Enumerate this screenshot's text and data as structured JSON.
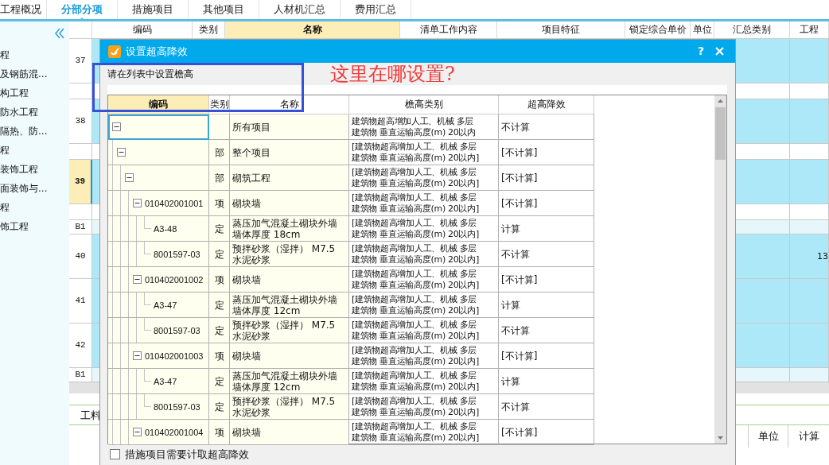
{
  "tabs": [
    {
      "label": "工程概况",
      "selected": false
    },
    {
      "label": "分部分项",
      "selected": true
    },
    {
      "label": "措施项目",
      "selected": false
    },
    {
      "label": "其他项目",
      "selected": false
    },
    {
      "label": "人材机汇总",
      "selected": false
    },
    {
      "label": "费用汇总",
      "selected": false
    }
  ],
  "sidebar": {
    "items": [
      "程",
      "及钢筋混...",
      "构工程",
      "防水工程",
      "隔热、防...",
      "程",
      "装饰工程",
      "面装饰与...",
      "程",
      "饰工程"
    ]
  },
  "table": {
    "columns": [
      {
        "label": "编码",
        "selected": false
      },
      {
        "label": "类别",
        "selected": false
      },
      {
        "label": "名称",
        "selected": true
      },
      {
        "label": "清单工作内容",
        "selected": false
      },
      {
        "label": "项目特征",
        "selected": false
      },
      {
        "label": "锁定综合单价",
        "selected": false
      },
      {
        "label": "单位",
        "selected": false
      },
      {
        "label": "汇总类别",
        "selected": false
      },
      {
        "label": "工程",
        "selected": false
      }
    ],
    "rows": [
      {
        "kind": "item",
        "number": "37",
        "selected": false
      },
      {
        "kind": "blank",
        "selected": false
      },
      {
        "kind": "item",
        "number": "38",
        "selected": false
      },
      {
        "kind": "blank",
        "selected": false
      },
      {
        "kind": "item",
        "number": "39",
        "selected": true
      },
      {
        "kind": "blank",
        "selected": false
      },
      {
        "kind": "sub",
        "number": "B1",
        "selected": false
      },
      {
        "kind": "item",
        "number": "40",
        "selected": false,
        "last_column": "13"
      },
      {
        "kind": "item",
        "number": "41",
        "selected": false
      },
      {
        "kind": "item",
        "number": "42",
        "selected": false
      },
      {
        "kind": "sub",
        "number": "B1",
        "selected": false
      }
    ]
  },
  "bottom_panel": {
    "tab": "工料",
    "columns": [
      "单位",
      "计算"
    ]
  },
  "dialog": {
    "title": "设置超高降效",
    "help": "?",
    "prompt": "请在列表中设置檐高",
    "annotation": "这里在哪设置?",
    "columns": [
      {
        "label": "编码",
        "selected": true
      },
      {
        "label": "类别",
        "selected": false
      },
      {
        "label": "名称",
        "selected": false
      },
      {
        "label": "檐高类别",
        "selected": false
      },
      {
        "label": "超高降效",
        "selected": false
      }
    ],
    "tree": [
      {
        "name": [
          "所有项目"
        ],
        "height_category": [
          "建筑物超高增加人工、机械 多层",
          "建筑物 垂直运输高度(m) 20以内"
        ],
        "reduction": "不计算",
        "expanded": true,
        "selected": true,
        "children": [
          {
            "type": "部",
            "name": [
              "整个项目"
            ],
            "height_category": [
              "[建筑物超高增加人工、机械 多层",
              "建筑物 垂直运输高度(m) 20以内]"
            ],
            "reduction": "[不计算]",
            "expanded": true,
            "selected": false,
            "children": [
              {
                "type": "部",
                "name": [
                  "砌筑工程"
                ],
                "height_category": [
                  "[建筑物超高增加人工、机械 多层",
                  "建筑物 垂直运输高度(m) 20以内]"
                ],
                "reduction": "[不计算]",
                "expanded": true,
                "selected": false,
                "children": [
                  {
                    "code": "010402001001",
                    "type": "项",
                    "name": [
                      "砌块墙"
                    ],
                    "height_category": [
                      "[建筑物超高增加人工、机械 多层",
                      "建筑物 垂直运输高度(m) 20以内]"
                    ],
                    "reduction": "[不计算]",
                    "expanded": true,
                    "selected": false,
                    "children": [
                      {
                        "code": "A3-48",
                        "type": "定",
                        "name": [
                          "蒸压加气混凝土砌块外墙",
                          "墙体厚度 18cm"
                        ],
                        "height_category": [
                          "[建筑物超高增加人工、机械 多层",
                          "建筑物 垂直运输高度(m) 20以内]"
                        ],
                        "reduction": "计算",
                        "selected": false
                      },
                      {
                        "code": "8001597-03",
                        "type": "定",
                        "name": [
                          "预拌砂浆（湿拌） M7.5",
                          "水泥砂浆"
                        ],
                        "height_category": [
                          "[建筑物超高增加人工、机械 多层",
                          "建筑物 垂直运输高度(m) 20以内]"
                        ],
                        "reduction": "不计算",
                        "selected": false
                      }
                    ]
                  },
                  {
                    "code": "010402001002",
                    "type": "项",
                    "name": [
                      "砌块墙"
                    ],
                    "height_category": [
                      "[建筑物超高增加人工、机械 多层",
                      "建筑物 垂直运输高度(m) 20以内]"
                    ],
                    "reduction": "[不计算]",
                    "expanded": true,
                    "selected": false,
                    "children": [
                      {
                        "code": "A3-47",
                        "type": "定",
                        "name": [
                          "蒸压加气混凝土砌块外墙",
                          "墙体厚度 12cm"
                        ],
                        "height_category": [
                          "[建筑物超高增加人工、机械 多层",
                          "建筑物 垂直运输高度(m) 20以内]"
                        ],
                        "reduction": "计算",
                        "selected": false
                      },
                      {
                        "code": "8001597-03",
                        "type": "定",
                        "name": [
                          "预拌砂浆（湿拌） M7.5",
                          "水泥砂浆"
                        ],
                        "height_category": [
                          "[建筑物超高增加人工、机械 多层",
                          "建筑物 垂直运输高度(m) 20以内]"
                        ],
                        "reduction": "不计算",
                        "selected": false
                      }
                    ]
                  },
                  {
                    "code": "010402001003",
                    "type": "项",
                    "name": [
                      "砌块墙"
                    ],
                    "height_category": [
                      "[建筑物超高增加人工、机械 多层",
                      "建筑物 垂直运输高度(m) 20以内]"
                    ],
                    "reduction": "[不计算]",
                    "expanded": true,
                    "selected": false,
                    "children": [
                      {
                        "code": "A3-47",
                        "type": "定",
                        "name": [
                          "蒸压加气混凝土砌块外墙",
                          "墙体厚度 12cm"
                        ],
                        "height_category": [
                          "[建筑物超高增加人工、机械 多层",
                          "建筑物 垂直运输高度(m) 20以内]"
                        ],
                        "reduction": "计算",
                        "selected": false
                      },
                      {
                        "code": "8001597-03",
                        "type": "定",
                        "name": [
                          "预拌砂浆（湿拌） M7.5",
                          "水泥砂浆"
                        ],
                        "height_category": [
                          "[建筑物超高增加人工、机械 多层",
                          "建筑物 垂直运输高度(m) 20以内]"
                        ],
                        "reduction": "不计算",
                        "selected": false
                      }
                    ]
                  },
                  {
                    "code": "010402001004",
                    "type": "项",
                    "name": [
                      "砌块墙"
                    ],
                    "height_category": [
                      "[建筑物超高增加人工、机械 多层",
                      "建筑物 垂直运输高度(m) 20以内]"
                    ],
                    "reduction": "[不计算]",
                    "expanded": true,
                    "selected": false
                  }
                ]
              }
            ]
          }
        ]
      }
    ],
    "checkbox": {
      "label": "措施项目需要计取超高降效",
      "checked": false
    }
  }
}
